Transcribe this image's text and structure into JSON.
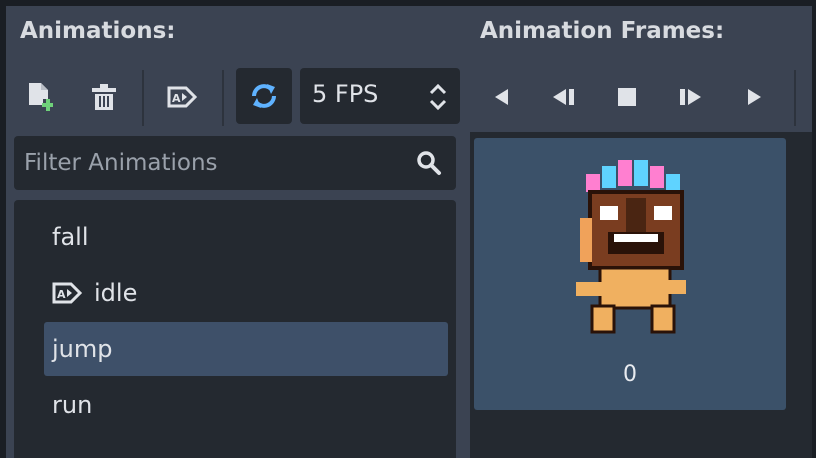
{
  "headers": {
    "animations": "Animations:",
    "frames": "Animation Frames:"
  },
  "toolbar": {
    "new_animation_icon": "new-animation-icon",
    "delete_animation_icon": "trash-icon",
    "autoplay_icon": "autoplay-icon",
    "loop_icon": "loop-icon",
    "fps_value": "5 FPS",
    "playback": [
      "play-backwards-icon",
      "play-backwards-from-end-icon",
      "stop-icon",
      "play-from-start-icon",
      "play-icon"
    ],
    "loop_active_color": "#5fb2ff"
  },
  "filter": {
    "placeholder": "Filter Animations",
    "icon": "search-icon"
  },
  "animations": [
    {
      "name": "fall",
      "autoplay": false,
      "selected": false
    },
    {
      "name": "idle",
      "autoplay": true,
      "selected": false
    },
    {
      "name": "jump",
      "autoplay": false,
      "selected": true
    },
    {
      "name": "run",
      "autoplay": false,
      "selected": false
    }
  ],
  "frames": [
    {
      "index": "0"
    }
  ],
  "colors": {
    "accent": "#5fb2ff",
    "selection": "#3e5069",
    "panel": "#242930",
    "frame_bg": "#3b5169"
  }
}
